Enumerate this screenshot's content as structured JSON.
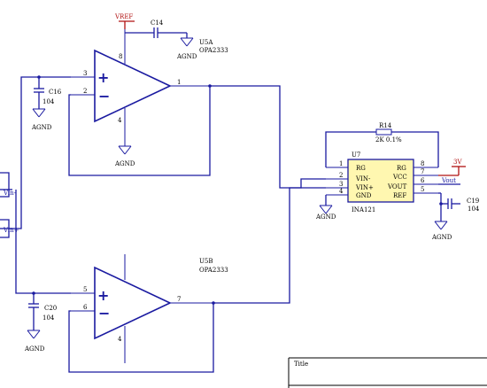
{
  "u5a": {
    "ref": "U5A",
    "part": "OPA2333",
    "pin_in_plus": "3",
    "pin_in_minus": "2",
    "pin_out": "1",
    "pin_pwr": "8",
    "pin_gnd": "4"
  },
  "u5b": {
    "ref": "U5B",
    "part": "OPA2333",
    "pin_in_plus": "5",
    "pin_in_minus": "6",
    "pin_out": "7",
    "pin_gnd": "4"
  },
  "u7": {
    "ref": "U7",
    "part": "INA121",
    "left_pins": [
      {
        "num": "1",
        "name": "RG"
      },
      {
        "num": "2",
        "name": "VIN-"
      },
      {
        "num": "3",
        "name": "VIN+"
      },
      {
        "num": "4",
        "name": "GND"
      }
    ],
    "right_pins": [
      {
        "num": "8",
        "name": "RG"
      },
      {
        "num": "7",
        "name": "VCC"
      },
      {
        "num": "6",
        "name": "VOUT"
      },
      {
        "num": "5",
        "name": "REF"
      }
    ]
  },
  "components": {
    "c14": "C14",
    "c16": "C16",
    "c16_val": "104",
    "c20": "C20",
    "c20_val": "104",
    "c19": "C19",
    "c19_val": "104",
    "r14": "R14",
    "r14_val": "2K 0.1%"
  },
  "nets": {
    "vref": "VREF",
    "v3": "3V",
    "vout": "Vout",
    "vin_minus": "Vin-",
    "vin_plus": "Vin+",
    "agnd": "AGND"
  },
  "title_block": {
    "title_label": "Title"
  },
  "colors": {
    "wire": "#1a1aa0",
    "power": "#b01010",
    "chip_fill": "#fff7b0"
  }
}
